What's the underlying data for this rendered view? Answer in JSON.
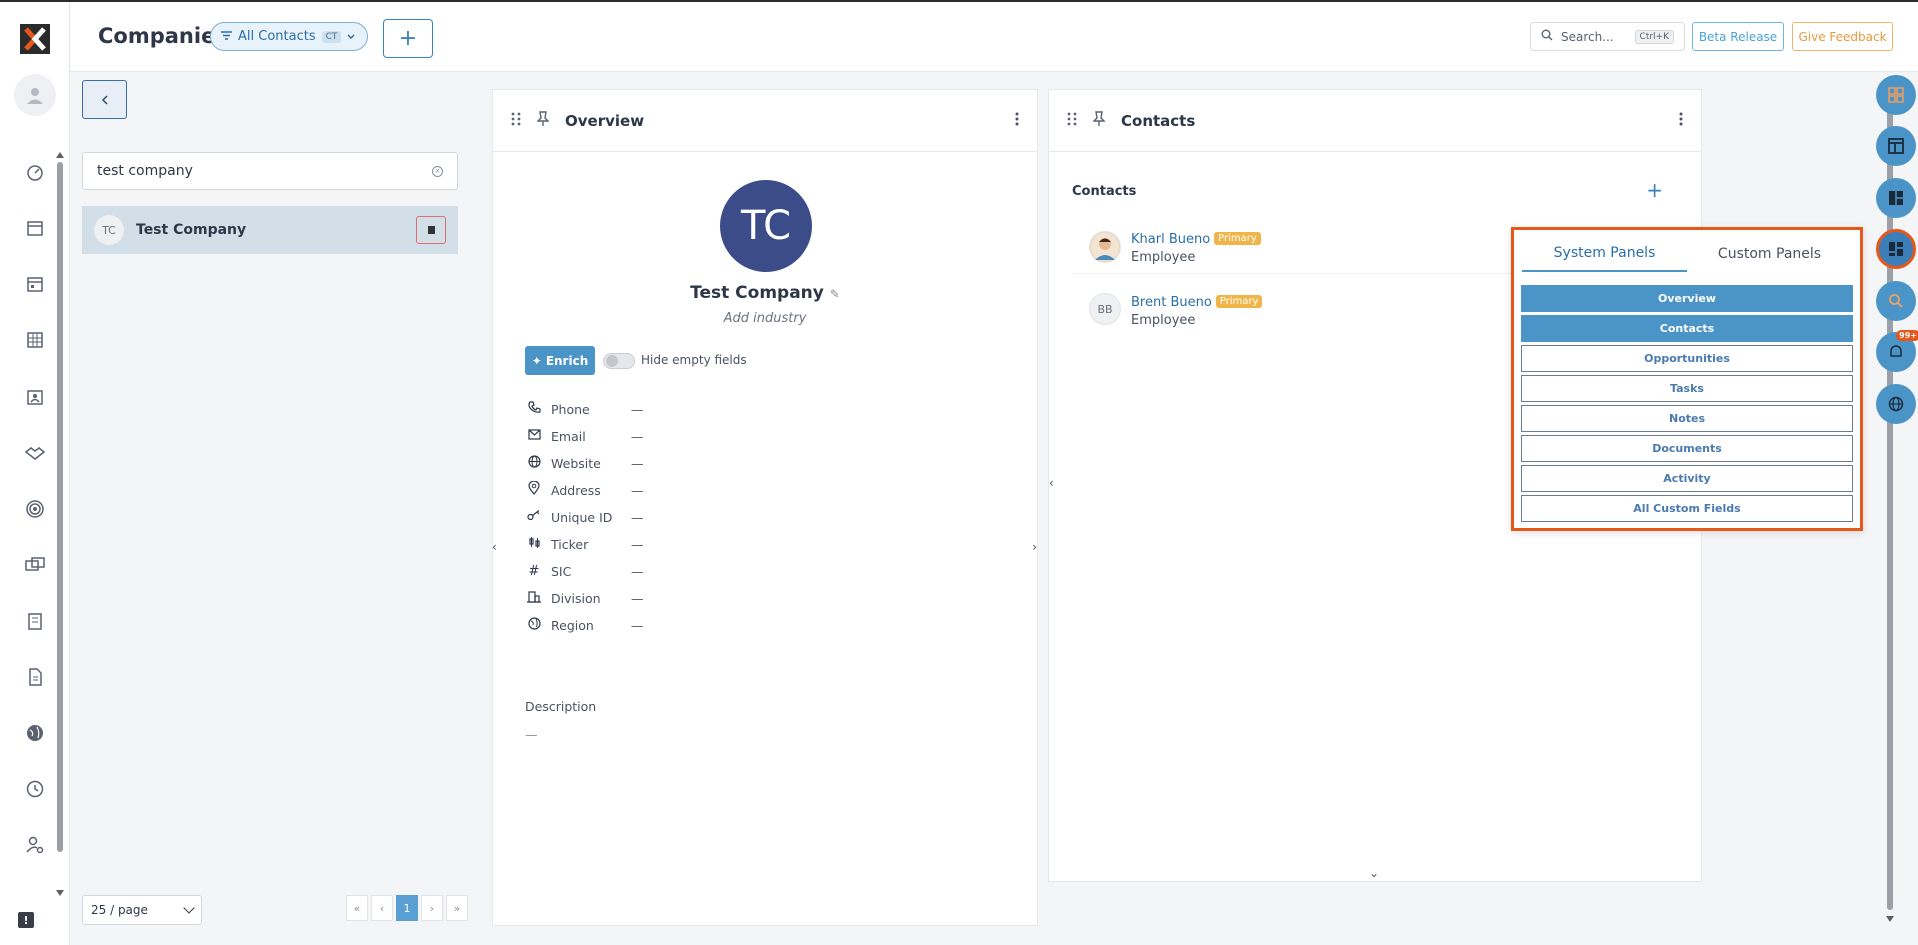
{
  "header": {
    "title": "Companies",
    "view_label": "All Contacts",
    "view_badge": "CT",
    "add_label": "+",
    "search_placeholder": "Search...",
    "search_shortcut": "Ctrl+K",
    "beta_label": "Beta Release",
    "feedback_label": "Give Feedback"
  },
  "list": {
    "search_value": "test company",
    "rows": [
      {
        "initials": "TC",
        "name": "Test Company"
      }
    ],
    "page_size": "25 / page",
    "pager": {
      "first": "«",
      "prev": "‹",
      "current": "1",
      "next": "›",
      "last": "»"
    }
  },
  "overview": {
    "title": "Overview",
    "avatar_initials": "TC",
    "company_name": "Test Company",
    "industry_placeholder": "Add industry",
    "enrich_label": "Enrich",
    "toggle_label": "Hide empty fields",
    "fields": [
      {
        "label": "Phone",
        "value": "—"
      },
      {
        "label": "Email",
        "value": "—"
      },
      {
        "label": "Website",
        "value": "—"
      },
      {
        "label": "Address",
        "value": "—"
      },
      {
        "label": "Unique ID",
        "value": "—"
      },
      {
        "label": "Ticker",
        "value": "—"
      },
      {
        "label": "SIC",
        "value": "—"
      },
      {
        "label": "Division",
        "value": "—"
      },
      {
        "label": "Region",
        "value": "—"
      }
    ],
    "description_label": "Description",
    "description_value": "—"
  },
  "contacts": {
    "title": "Contacts",
    "subtitle": "Contacts",
    "rows": [
      {
        "initials": "",
        "name": "Kharl Bueno",
        "badge": "Primary",
        "role": "Employee"
      },
      {
        "initials": "BB",
        "name": "Brent Bueno",
        "badge": "Primary",
        "role": "Employee"
      }
    ]
  },
  "picker": {
    "tabs": [
      "System Panels",
      "Custom Panels"
    ],
    "items": [
      {
        "label": "Overview",
        "on": true
      },
      {
        "label": "Contacts",
        "on": true
      },
      {
        "label": "Opportunities",
        "on": false
      },
      {
        "label": "Tasks",
        "on": false
      },
      {
        "label": "Notes",
        "on": false
      },
      {
        "label": "Documents",
        "on": false
      },
      {
        "label": "Activity",
        "on": false
      },
      {
        "label": "All Custom Fields",
        "on": false
      }
    ]
  },
  "right_rail": {
    "notification_count": "99+"
  }
}
